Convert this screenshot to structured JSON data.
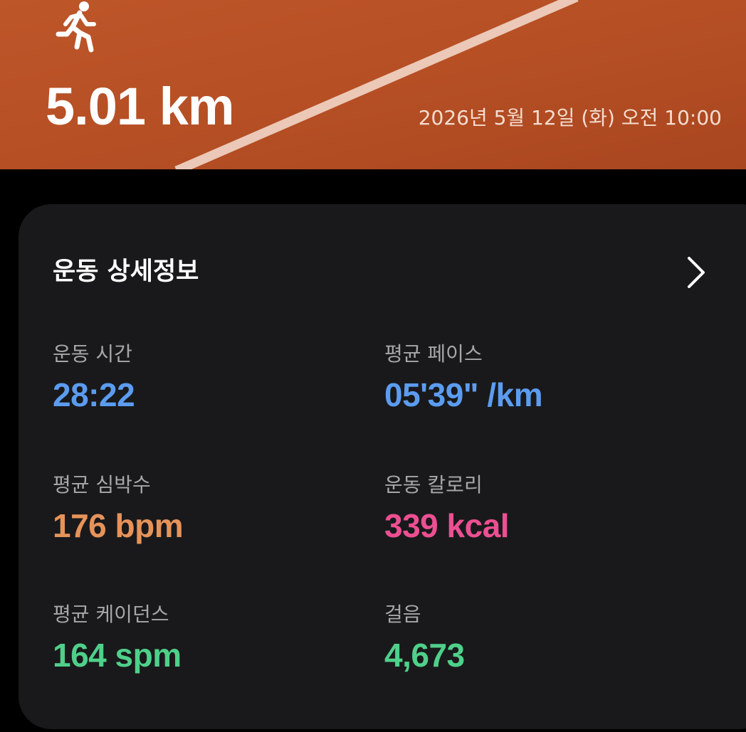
{
  "header": {
    "activity_icon": "running-person-icon",
    "distance": "5.01 km",
    "datetime": "2026년 5월 12일 (화) 오전 10:00",
    "track_color": "#b85026",
    "track_line_color": "#f2d6c8"
  },
  "card": {
    "title": "운동 상세정보",
    "chevron_icon": "chevron-right-icon",
    "stats": [
      {
        "label": "운동 시간",
        "value": "28:22",
        "color": "#5b9cf0"
      },
      {
        "label": "평균 페이스",
        "value": "05'39\" /km",
        "color": "#5b9cf0"
      },
      {
        "label": "평균 심박수",
        "value": "176 bpm",
        "color": "#e6935a"
      },
      {
        "label": "운동 칼로리",
        "value": "339 kcal",
        "color": "#ec4f92"
      },
      {
        "label": "평균 케이던스",
        "value": "164 spm",
        "color": "#4fd08a"
      },
      {
        "label": "걸음",
        "value": "4,673",
        "color": "#4fd08a"
      }
    ]
  }
}
